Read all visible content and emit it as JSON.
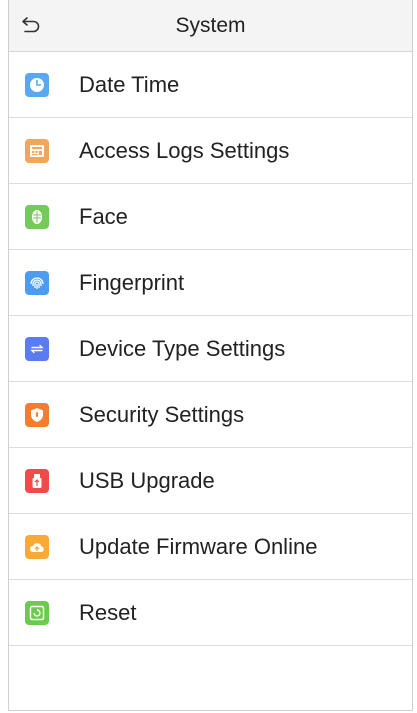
{
  "header": {
    "title": "System",
    "back_icon": "back-arrow-icon"
  },
  "menu": {
    "items": [
      {
        "label": "Date Time",
        "icon": "clock-icon",
        "color": "#5aa9ef"
      },
      {
        "label": "Access Logs Settings",
        "icon": "log-icon",
        "color": "#f2a65a"
      },
      {
        "label": "Face",
        "icon": "face-icon",
        "color": "#76c95d"
      },
      {
        "label": "Fingerprint",
        "icon": "fingerprint-icon",
        "color": "#4c9df2"
      },
      {
        "label": "Device Type Settings",
        "icon": "device-type-icon",
        "color": "#5b7cf0"
      },
      {
        "label": "Security Settings",
        "icon": "shield-icon",
        "color": "#f37c2e"
      },
      {
        "label": "USB Upgrade",
        "icon": "usb-icon",
        "color": "#f04a4a"
      },
      {
        "label": "Update Firmware Online",
        "icon": "cloud-upload-icon",
        "color": "#f8aa35"
      },
      {
        "label": "Reset",
        "icon": "reset-icon",
        "color": "#6ccb4f"
      }
    ]
  }
}
